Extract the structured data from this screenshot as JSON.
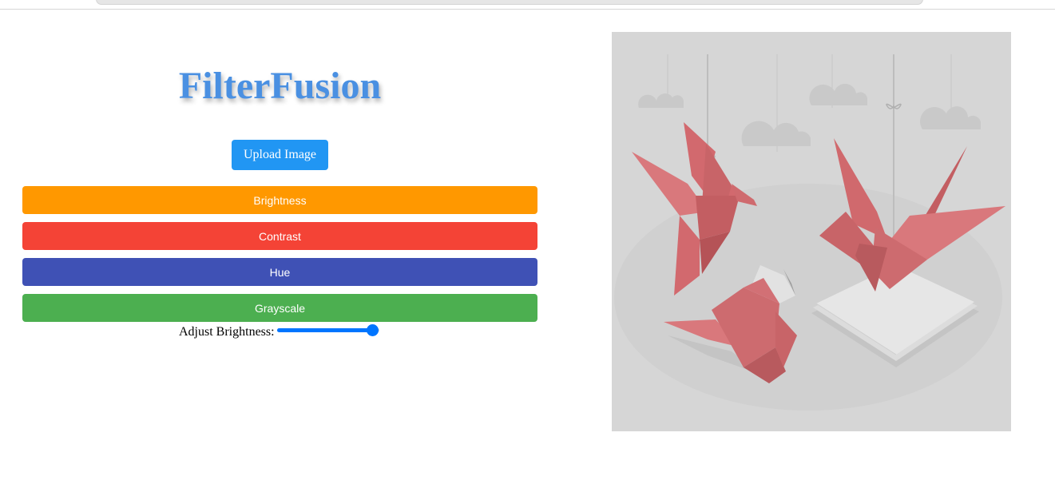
{
  "app": {
    "title": "FilterFusion"
  },
  "toolbar": {
    "upload_label": "Upload Image"
  },
  "filters": [
    {
      "label": "Brightness",
      "color": "#ff9800"
    },
    {
      "label": "Contrast",
      "color": "#f44336"
    },
    {
      "label": "Hue",
      "color": "#3f51b5"
    },
    {
      "label": "Grayscale",
      "color": "#4caf50"
    }
  ],
  "adjust": {
    "label": "Adjust Brightness:",
    "value_fraction": 0.93,
    "accent": "#0075ff"
  },
  "preview": {
    "background": "#d6d6d6",
    "accent": "#cd6b6f"
  },
  "colors": {
    "title": "#4a90e2",
    "upload": "#2196f3"
  }
}
